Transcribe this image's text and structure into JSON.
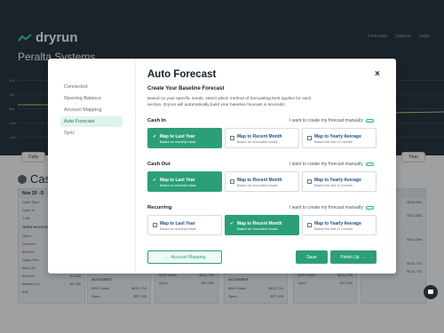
{
  "app": {
    "brand": "dryrun",
    "company": "Peralta Systems",
    "nav": [
      "Forecasts",
      "Support",
      "Login"
    ]
  },
  "chart_ticks": [
    "40k",
    "20k",
    "$0k",
    "-20k",
    "-40k"
  ],
  "controls": {
    "daily": "Daily",
    "total": "Total"
  },
  "cash_title": "Cash",
  "columns": {
    "c1": {
      "head": "Nov 20 - D",
      "rows": [
        "Cash Start",
        "Cash In"
      ],
      "add": "+ Ad",
      "open_invoices": "OPEN INVOICES",
      "open_label": "Open",
      "overdue": "Overdue",
      "vendors": [
        "Bolt Inc.",
        "Dag's Rea",
        "Alec Ltd.",
        "Axe Ltd.",
        "Atlantic Inc."
      ],
      "amounts": [
        "$12,200",
        "$1,323",
        "$3,750"
      ],
      "ar": [
        "A/R"
      ]
    },
    "c2": {
      "label": "ACCOUNTS",
      "sub": "6000 Sales",
      "open": "Open",
      "amount": "$131,734",
      "amount2": "$57,000"
    },
    "c3": {
      "label": "ACCOUNTS",
      "sub": "6000 Sales",
      "open": "Open",
      "amount": "$131,734",
      "amount2": "$57,000"
    },
    "c4": {
      "label": "ACCOUNTS",
      "sub": "6000 Sales",
      "open": "Open",
      "amount": "$131,734",
      "amount2": "$57,000"
    },
    "c5": {
      "label": "ACCOUNTS",
      "sub": "6000 Sales",
      "open": "Open",
      "amount": "$131,734",
      "amount2": "$57,000"
    },
    "c6": {
      "head": "29",
      "v1": "$263,664",
      "v2": "$112,553",
      "v3": "$151,084",
      "v4": "$151,734",
      "v5": "$131,734"
    }
  },
  "modal": {
    "title": "Auto Forecast",
    "close": "×",
    "steps": [
      "Connected",
      "Opening Balance",
      "Account Mapping",
      "Auto Forecast",
      "Sync"
    ],
    "active_step": 3,
    "subtitle": "Create Your Baseline Forecast",
    "description": "Based on your specific needs, select which method of forecasting best applies for each section. Dryrun will automatically build your baseline forecast in seconds!",
    "manual_label": "I want to create my forecast manually",
    "sections": [
      {
        "label": "Cash In",
        "options": [
          {
            "title": "Map to Last Year",
            "hint": "Based on monthly totals",
            "selected": true
          },
          {
            "title": "Map to Recent Month",
            "hint": "Based on reconciled books",
            "selected": false
          },
          {
            "title": "Map to Yearly Average",
            "hint": "Based the last 12 months",
            "selected": false
          }
        ]
      },
      {
        "label": "Cash Out",
        "options": [
          {
            "title": "Map to Last Year",
            "hint": "Based on monthly totals",
            "selected": true
          },
          {
            "title": "Map to Recent Month",
            "hint": "Based on reconciled books",
            "selected": false
          },
          {
            "title": "Map to Yearly Average",
            "hint": "Based the last 12 months",
            "selected": false
          }
        ]
      },
      {
        "label": "Recurring",
        "options": [
          {
            "title": "Map to Last Year",
            "hint": "Based on monthly totals",
            "selected": false
          },
          {
            "title": "Map to Recent Month",
            "hint": "Based on reconciled books",
            "selected": true
          },
          {
            "title": "Map to Yearly Average",
            "hint": "Based the last 12 months",
            "selected": false
          }
        ]
      }
    ],
    "back_button": "Account Mapping",
    "save_button": "Save",
    "finish_button": "Finish Up"
  },
  "colors": {
    "accent": "#2c9f78",
    "header_bg": "#101b26"
  }
}
